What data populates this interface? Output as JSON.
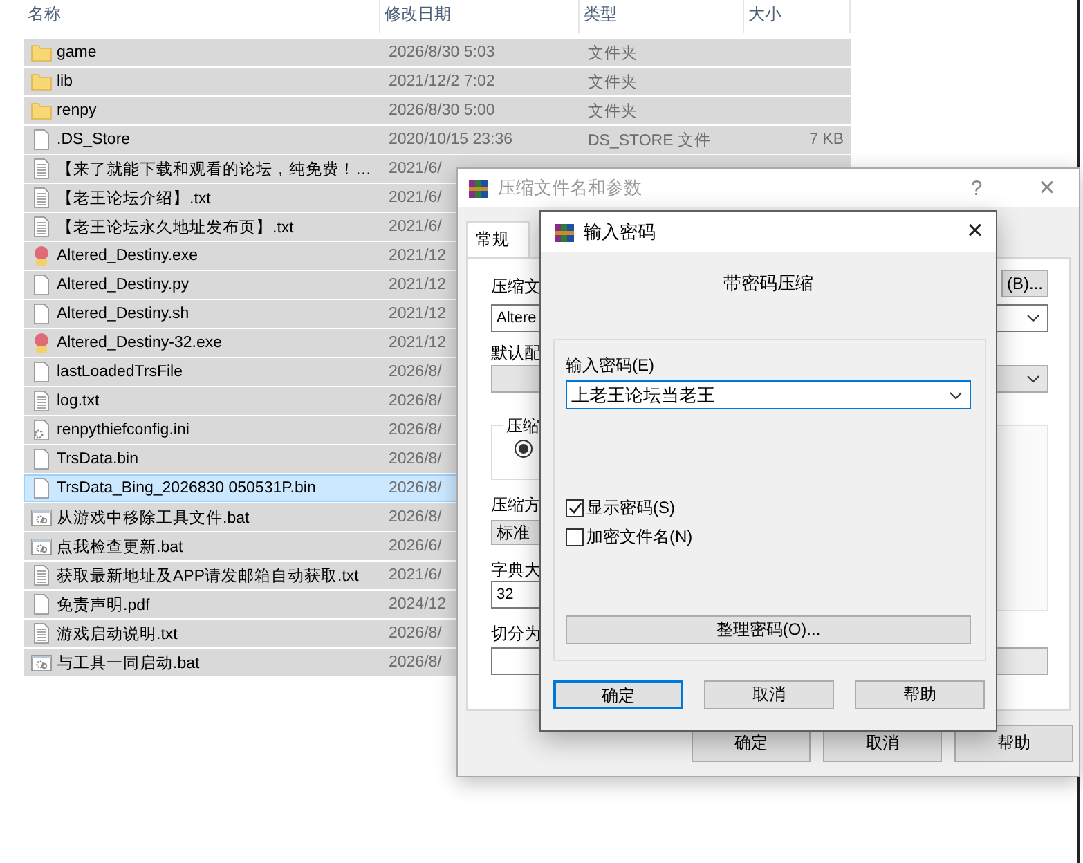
{
  "explorer": {
    "columns": [
      "名称",
      "修改日期",
      "类型",
      "大小"
    ],
    "rows": [
      {
        "name": "game",
        "date": "2026/8/30 5:03",
        "type": "文件夹",
        "kind": "folder",
        "selected": true,
        "focused": false
      },
      {
        "name": "lib",
        "date": "2021/12/2 7:02",
        "type": "文件夹",
        "kind": "folder",
        "selected": true,
        "focused": false
      },
      {
        "name": "renpy",
        "date": "2026/8/30 5:00",
        "type": "文件夹",
        "kind": "folder",
        "selected": true,
        "focused": false
      },
      {
        "name": ".DS_Store",
        "date": "2020/10/15 23:36",
        "type": "DS_STORE 文件",
        "size": "7 KB",
        "kind": "file",
        "selected": true,
        "focused": false
      },
      {
        "name": "【来了就能下载和观看的论坛，纯免费！…",
        "date": "2021/6/",
        "kind": "text",
        "selected": true,
        "focused": false
      },
      {
        "name": "【老王论坛介绍】.txt",
        "date": "2021/6/",
        "kind": "text",
        "selected": true,
        "focused": false
      },
      {
        "name": "【老王论坛永久地址发布页】.txt",
        "date": "2021/6/",
        "kind": "text",
        "selected": true,
        "focused": false
      },
      {
        "name": "Altered_Destiny.exe",
        "date": "2021/12",
        "kind": "app",
        "selected": true,
        "focused": false
      },
      {
        "name": "Altered_Destiny.py",
        "date": "2021/12",
        "kind": "file",
        "selected": true,
        "focused": false
      },
      {
        "name": "Altered_Destiny.sh",
        "date": "2021/12",
        "kind": "file",
        "selected": true,
        "focused": false
      },
      {
        "name": "Altered_Destiny-32.exe",
        "date": "2021/12",
        "kind": "app",
        "selected": true,
        "focused": false
      },
      {
        "name": "lastLoadedTrsFile",
        "date": "2026/8/",
        "kind": "file",
        "selected": true,
        "focused": false
      },
      {
        "name": "log.txt",
        "date": "2026/8/",
        "kind": "text",
        "selected": true,
        "focused": false
      },
      {
        "name": "renpythiefconfig.ini",
        "date": "2026/8/",
        "kind": "config",
        "selected": true,
        "focused": false
      },
      {
        "name": "TrsData.bin",
        "date": "2026/8/",
        "kind": "file",
        "selected": true,
        "focused": false
      },
      {
        "name": "TrsData_Bing_2026830 050531P.bin",
        "date": "2026/8/",
        "kind": "file",
        "selected": false,
        "focused": true
      },
      {
        "name": "从游戏中移除工具文件.bat",
        "date": "2026/8/",
        "kind": "batch",
        "selected": true,
        "focused": false
      },
      {
        "name": "点我检查更新.bat",
        "date": "2026/6/",
        "kind": "batch",
        "selected": true,
        "focused": false
      },
      {
        "name": "获取最新地址及APP请发邮箱自动获取.txt",
        "date": "2021/6/",
        "kind": "text",
        "selected": true,
        "focused": false
      },
      {
        "name": "免责声明.pdf",
        "date": "2024/12",
        "kind": "file",
        "selected": true,
        "focused": false
      },
      {
        "name": "游戏启动说明.txt",
        "date": "2026/8/",
        "kind": "text",
        "selected": true,
        "focused": false
      },
      {
        "name": "与工具一同启动.bat",
        "date": "2026/8/",
        "kind": "batch",
        "selected": true,
        "focused": false
      }
    ]
  },
  "archive_dialog": {
    "title": "压缩文件名和参数",
    "help": "?",
    "close": "×",
    "tabs": [
      {
        "label": "常规",
        "selected": true
      }
    ],
    "archive_name": {
      "label": "压缩文",
      "value": "Altere",
      "browse": "(B)..."
    },
    "profile": {
      "label": "默认配"
    },
    "format_group": {
      "label": "压缩",
      "selected": true
    },
    "method": {
      "label": "压缩方",
      "value": "标准"
    },
    "dictionary": {
      "label": "字典大",
      "value": "32"
    },
    "split": {
      "label": "切分为"
    },
    "buttons": [
      "确定",
      "取消",
      "帮助"
    ]
  },
  "password_dialog": {
    "title": "输入密码",
    "close": "×",
    "heading": "带密码压缩",
    "field_label": "输入密码(E)",
    "password": "上老王论坛当老王",
    "options": [
      {
        "label": "显示密码(S)",
        "checked": true
      },
      {
        "label": "加密文件名(N)",
        "checked": false
      }
    ],
    "organize": "整理密码(O)...",
    "buttons": [
      {
        "label": "确定",
        "default": true
      },
      {
        "label": "取消",
        "default": false
      },
      {
        "label": "帮助",
        "default": false
      }
    ]
  }
}
